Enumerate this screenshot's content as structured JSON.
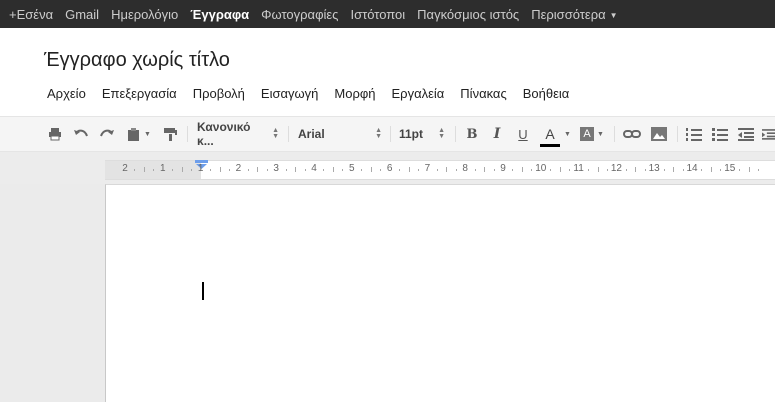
{
  "gbar": {
    "items": [
      {
        "label": "+Εσένα"
      },
      {
        "label": "Gmail"
      },
      {
        "label": "Ημερολόγιο"
      },
      {
        "label": "Έγγραφα",
        "active": true
      },
      {
        "label": "Φωτογραφίες"
      },
      {
        "label": "Ιστότοποι"
      },
      {
        "label": "Παγκόσμιος ιστός"
      },
      {
        "label": "Περισσότερα"
      }
    ]
  },
  "document": {
    "title": "Έγγραφο χωρίς τίτλο"
  },
  "menu": {
    "items": [
      "Αρχείο",
      "Επεξεργασία",
      "Προβολή",
      "Εισαγωγή",
      "Μορφή",
      "Εργαλεία",
      "Πίνακας",
      "Βοήθεια"
    ]
  },
  "toolbar": {
    "style_label": "Κανονικό κ...",
    "font_label": "Arial",
    "size_label": "11pt",
    "bold_label": "B",
    "italic_label": "I",
    "underline_label": "U",
    "text_color_label": "A",
    "highlight_label": "A",
    "icons": [
      "print-icon",
      "undo-icon",
      "redo-icon",
      "paint-format-icon",
      "paint-format-icon",
      "link-icon",
      "image-icon",
      "numbered-list-icon",
      "bulleted-list-icon",
      "decrease-indent-icon",
      "increase-indent-icon"
    ],
    "text_color": "#000000"
  },
  "ruler": {
    "labels": [
      "2",
      "1",
      "1",
      "2",
      "3",
      "4",
      "5",
      "6",
      "7",
      "8",
      "9",
      "10",
      "11",
      "12",
      "13",
      "14",
      "15"
    ]
  },
  "colors": {
    "gbar_bg": "#2d2d2d",
    "toolbar_bg": "#f5f5f5",
    "canvas_bg": "#ebebeb"
  }
}
